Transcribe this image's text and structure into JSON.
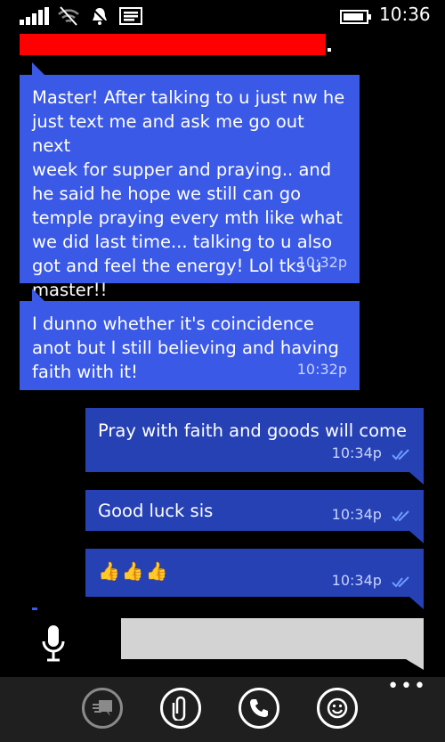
{
  "status_bar": {
    "time": "10:36",
    "icons": [
      "signal-icon",
      "wifi-icon",
      "bell-icon",
      "message-icon",
      "battery-icon"
    ]
  },
  "conversation": {
    "contact_name_redacted": true,
    "messages": [
      {
        "direction": "incoming",
        "text": "Master! After talking to u just nw he\njust text me and ask me go out next\nweek for supper and praying.. and\nhe said he hope we still can go\ntemple praying every mth like what\nwe did last time... talking to u also\ngot and feel the energy! Lol tks u\nmaster!!",
        "time": "10:32p"
      },
      {
        "direction": "incoming",
        "text": "I dunno whether it's coincidence\nanot but I still believing and having\nfaith with it!",
        "time": "10:32p"
      },
      {
        "direction": "outgoing",
        "text": "Pray with faith and goods will come",
        "time": "10:34p",
        "status": "read"
      },
      {
        "direction": "outgoing",
        "text": "Good luck sis",
        "time": "10:34p",
        "status": "read"
      },
      {
        "direction": "outgoing",
        "text": "👍👍👍",
        "time": "10:34p",
        "status": "read"
      }
    ]
  },
  "compose": {
    "placeholder": ""
  },
  "app_bar": {
    "buttons": [
      "speech-bubble-icon",
      "paperclip-icon",
      "phone-icon",
      "smiley-icon"
    ],
    "more_label": "•••"
  },
  "colors": {
    "incoming_bubble": "#3a59e6",
    "outgoing_bubble": "#2541b4",
    "redaction": "#ff0000",
    "app_bar": "#1f1f1f"
  }
}
